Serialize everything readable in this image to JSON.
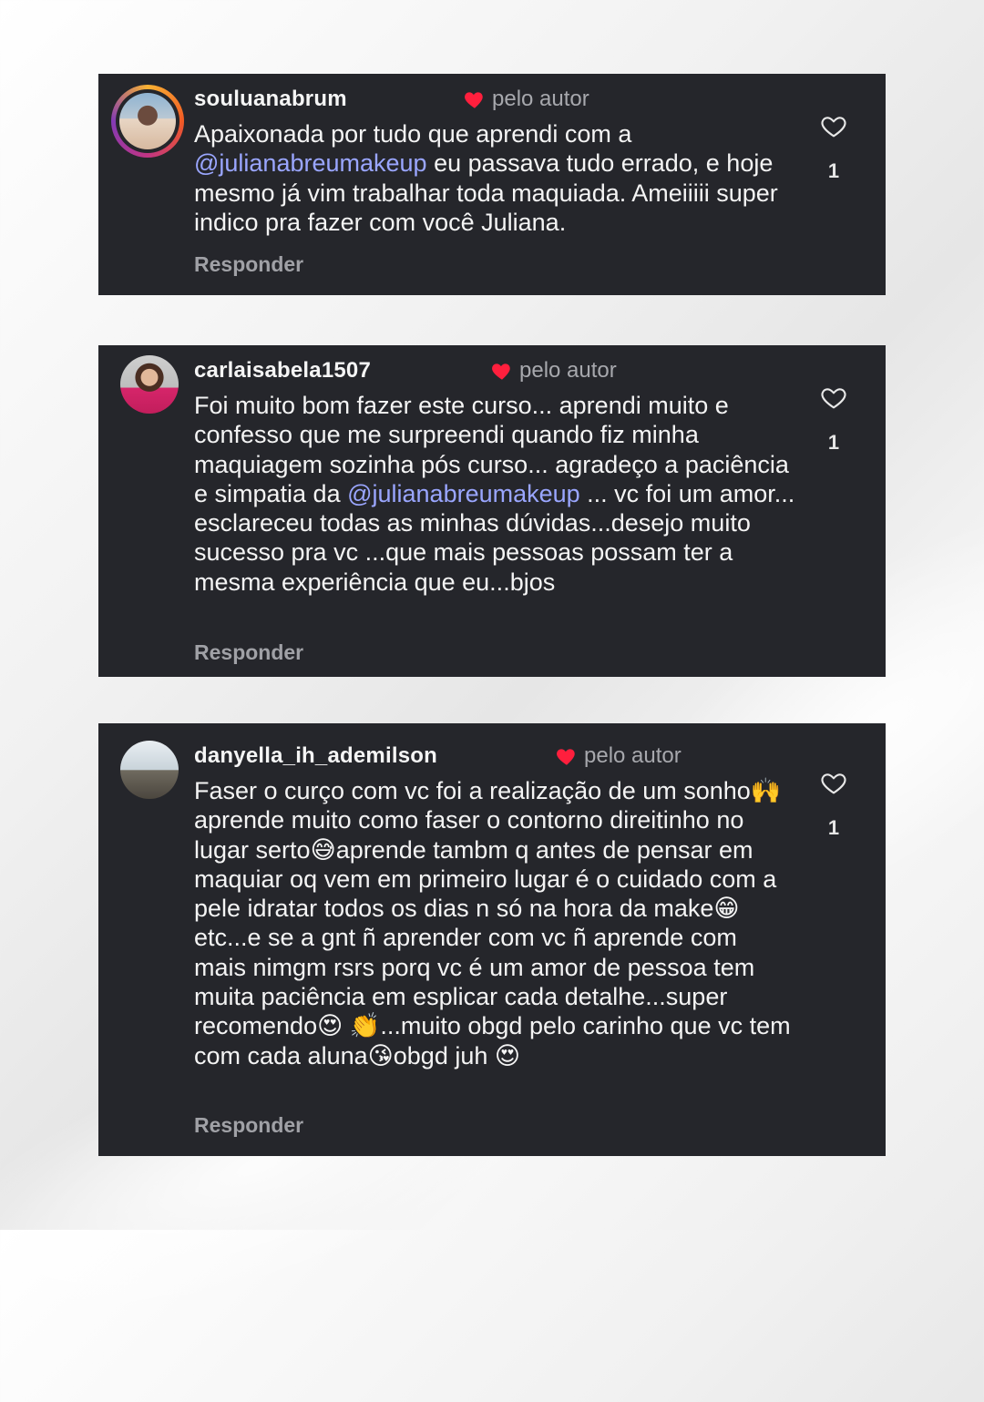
{
  "comments": [
    {
      "username": "souluanabrum",
      "badge": "pelo autor",
      "text_before": "Apaixonada por tudo que aprendi com a ",
      "mention": "@julianabreumakeup",
      "text_after": "  eu passava tudo errado, e hoje mesmo já vim trabalhar toda maquiada. Ameiiiii super indico pra fazer com você Juliana.",
      "reply_label": "Responder",
      "likes": "1"
    },
    {
      "username": "carlaisabela1507",
      "badge": "pelo autor",
      "text_before": "Foi muito bom fazer este curso... aprendi muito e confesso que me surpreendi quando fiz minha maquiagem sozinha pós curso... agradeço a paciência e simpatia da ",
      "mention": "@julianabreumakeup",
      "text_after": " ... vc foi um amor... esclareceu todas as minhas dúvidas...desejo muito sucesso pra vc ...que mais pessoas possam ter a mesma experiência que eu...bjos",
      "reply_label": "Responder",
      "likes": "1"
    },
    {
      "username": "danyella_ih_ademilson",
      "badge": "pelo autor",
      "text": "Faser o curço com vc foi a realização de um sonho🙌aprende muito como faser o contorno direitinho no lugar serto😅aprende tambm q antes de pensar em maquiar oq vem em primeiro lugar é o cuidado com a pele idratar todos os dias n só na hora da make😁etc...e se a gnt ñ aprender com vc ñ aprende com mais nimgm rsrs porq vc é um amor de pessoa tem muita paciência em esplicar cada detalhe...super recomendo😍 👏...muito obgd pelo carinho que vc tem com cada aluna😘obgd juh 😍",
      "reply_label": "Responder",
      "likes": "1"
    }
  ],
  "colors": {
    "card_bg": "#25262b",
    "mention": "#9aa6ff",
    "author_heart": "#ff1f3d"
  },
  "icons": {
    "like": "heart-outline-icon",
    "author_badge": "heart-filled-icon"
  }
}
